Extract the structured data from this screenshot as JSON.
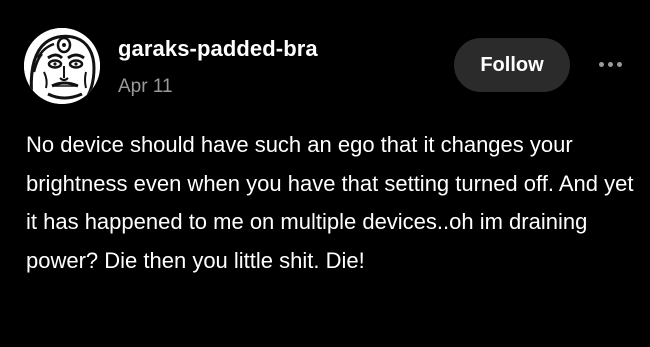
{
  "post": {
    "username": "garaks-padded-bra",
    "date": "Apr 11",
    "follow_label": "Follow",
    "more_icon": "more-horizontal-icon",
    "avatar_icon": "avatar-face-drawing",
    "body": "No device should have such an ego that it changes your brightness even when you have that setting turned off. And yet it has happened to me on multiple devices..oh im draining power? Die then you little shit. Die!"
  },
  "colors": {
    "background": "#000000",
    "text": "#ffffff",
    "muted": "#9a9a9a",
    "button_bg": "#2b2b2b"
  }
}
